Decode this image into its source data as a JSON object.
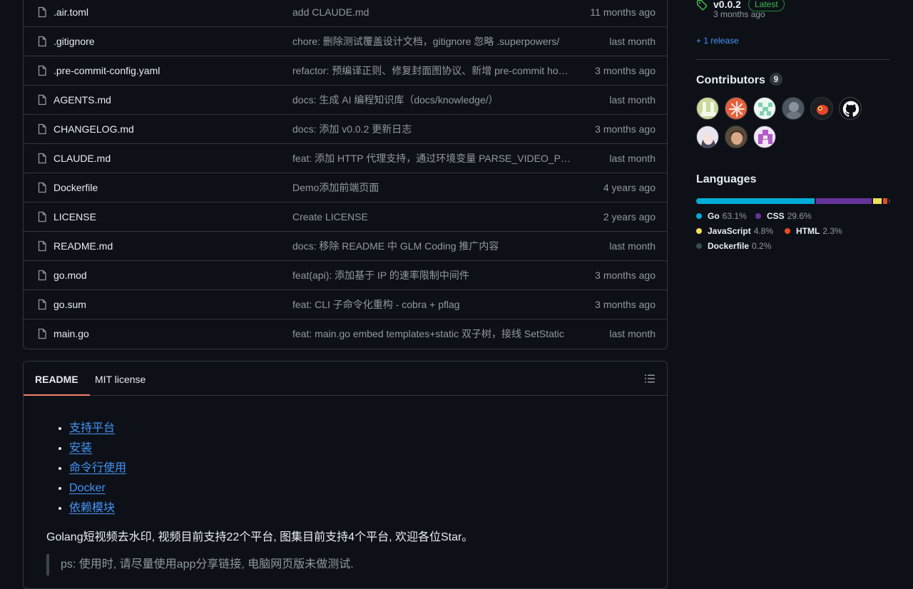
{
  "files": [
    {
      "name": ".air.toml",
      "message": "add CLAUDE.md",
      "time": "11 months ago"
    },
    {
      "name": ".gitignore",
      "message": "chore: 删除测试覆盖设计文档，gitignore 忽略 .superpowers/",
      "time": "last month"
    },
    {
      "name": ".pre-commit-config.yaml",
      "message": "refactor: 预编译正则、修复封面图协议、新增 pre-commit hooks",
      "time": "3 months ago"
    },
    {
      "name": "AGENTS.md",
      "message": "docs: 生成 AI 编程知识库（docs/knowledge/）",
      "time": "last month"
    },
    {
      "name": "CHANGELOG.md",
      "message": "docs: 添加 v0.0.2 更新日志",
      "time": "3 months ago"
    },
    {
      "name": "CLAUDE.md",
      "message": "feat: 添加 HTTP 代理支持，通过环境变量 PARSE_VIDEO_PROXY 配置",
      "time": "last month"
    },
    {
      "name": "Dockerfile",
      "message": "Demo添加前端页面",
      "time": "4 years ago"
    },
    {
      "name": "LICENSE",
      "message": "Create LICENSE",
      "time": "2 years ago"
    },
    {
      "name": "README.md",
      "message": "docs: 移除 README 中 GLM Coding 推广内容",
      "time": "last month"
    },
    {
      "name": "go.mod",
      "message": "feat(api): 添加基于 IP 的速率限制中间件",
      "time": "3 months ago"
    },
    {
      "name": "go.sum",
      "message": "feat: CLI 子命令化重构 - cobra + pflag",
      "time": "3 months ago"
    },
    {
      "name": "main.go",
      "message": "feat: main.go embed templates+static 双子树，接线 SetStatic",
      "time": "last month"
    }
  ],
  "readme": {
    "tabs": [
      {
        "label": "README"
      },
      {
        "label": "MIT license"
      }
    ],
    "toc": [
      {
        "label": "支持平台"
      },
      {
        "label": "安装"
      },
      {
        "label": "命令行使用"
      },
      {
        "label": "Docker"
      },
      {
        "label": "依赖模块"
      }
    ],
    "intro": "Golang短视频去水印, 视频目前支持22个平台, 图集目前支持4个平台, 欢迎各位Star。",
    "quote": "ps: 使用时, 请尽量使用app分享链接, 电脑网页版未做测试."
  },
  "sidebar": {
    "release": {
      "name": "v0.0.2",
      "badge": "Latest",
      "date": "3 months ago",
      "more": "+ 1 release"
    },
    "contributors": {
      "title": "Contributors",
      "count": "9"
    },
    "languages": {
      "title": "Languages",
      "items": [
        {
          "name": "Go",
          "percent": "63.1%",
          "value": 63.1,
          "color": "#00ADD8"
        },
        {
          "name": "CSS",
          "percent": "29.6%",
          "value": 29.6,
          "color": "#663399"
        },
        {
          "name": "JavaScript",
          "percent": "4.8%",
          "value": 4.8,
          "color": "#f1e05a"
        },
        {
          "name": "HTML",
          "percent": "2.3%",
          "value": 2.3,
          "color": "#e34c26"
        },
        {
          "name": "Dockerfile",
          "percent": "0.2%",
          "value": 0.2,
          "color": "#384d54"
        }
      ]
    }
  }
}
